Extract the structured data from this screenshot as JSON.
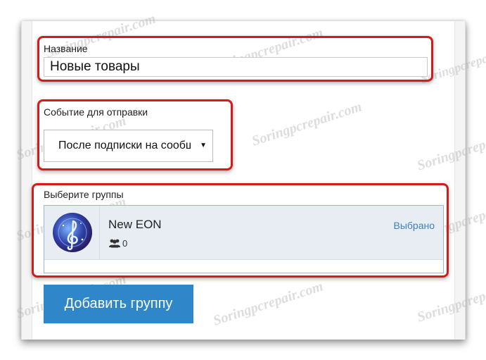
{
  "form": {
    "name_label": "Название",
    "name_value": "Новые товары",
    "event_label": "Событие для отправки",
    "event_selected": "После подписки на сообщения",
    "groups_label": "Выберите группы",
    "groups": [
      {
        "name": "New EON",
        "members": "0",
        "status": "Выбрано"
      }
    ],
    "add_button": "Добавить группу"
  },
  "watermark": "Soringpcrepair.com",
  "colors": {
    "highlight": "#d21c1c",
    "button": "#2f86c9",
    "link": "#3f7fbf",
    "row_bg": "#e7edf3"
  },
  "icons": {
    "select_arrow": "dropdown-arrow-icon",
    "members": "people-icon",
    "avatar": "treble-clef-avatar"
  }
}
